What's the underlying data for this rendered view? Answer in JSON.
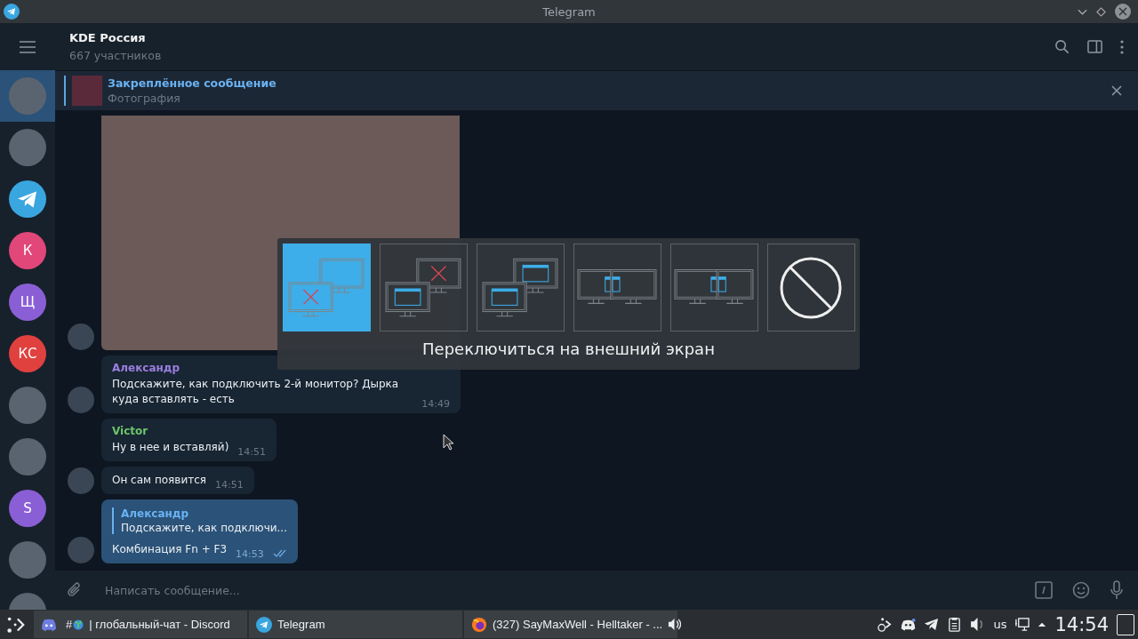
{
  "window": {
    "title": "Telegram"
  },
  "chat_list": [
    {
      "kind": "photo",
      "selected": true
    },
    {
      "kind": "photo",
      "selected": false
    },
    {
      "kind": "telegram",
      "selected": false
    },
    {
      "kind": "letter",
      "letter": "К",
      "color": "#e2477a",
      "selected": false
    },
    {
      "kind": "letter",
      "letter": "Щ",
      "color": "#8a5fd6",
      "selected": false
    },
    {
      "kind": "letter",
      "letter": "КС",
      "color": "#e0413f",
      "selected": false
    },
    {
      "kind": "photo",
      "selected": false
    },
    {
      "kind": "photo",
      "selected": false
    },
    {
      "kind": "letter",
      "letter": "S",
      "color": "#8a5fd6",
      "selected": false
    },
    {
      "kind": "photo",
      "selected": false
    },
    {
      "kind": "photo",
      "selected": false
    }
  ],
  "header": {
    "title": "KDE Россия",
    "subtitle": "667 участников"
  },
  "pinned": {
    "title": "Закреплённое сообщение",
    "text": "Фотография"
  },
  "messages": [
    {
      "kind": "photo",
      "avatar": true
    },
    {
      "kind": "text",
      "avatar": true,
      "author": "Александр",
      "color": "#9b7fe0",
      "text": "Подскажите, как подключить 2-й монитор? Дырка куда вставлять - есть",
      "time": "14:49"
    },
    {
      "kind": "text",
      "avatar": false,
      "author": "Victor",
      "color": "#6cc56a",
      "text": "Ну в нее и вставляй)",
      "time": "14:51"
    },
    {
      "kind": "text",
      "avatar": true,
      "text": "Он сам появится",
      "time": "14:51"
    },
    {
      "kind": "reply",
      "avatar": true,
      "reply_author": "Александр",
      "reply_text": "Подскажите, как подключи...",
      "text": "Комбинация Fn + F3",
      "time": "14:53",
      "read": true
    }
  ],
  "composer": {
    "placeholder": "Написать сообщение..."
  },
  "osd": {
    "caption": "Переключиться на внешний экран",
    "options": [
      {
        "kind": "external",
        "selected": true
      },
      {
        "kind": "internal",
        "selected": false
      },
      {
        "kind": "clone",
        "selected": false
      },
      {
        "kind": "extend-left",
        "selected": false
      },
      {
        "kind": "extend-right",
        "selected": false
      },
      {
        "kind": "none",
        "selected": false
      }
    ]
  },
  "taskbar": {
    "tasks": [
      {
        "kind": "discord",
        "prefix": "#",
        "label": "| глобальный-чат - Discord",
        "audio": false,
        "selected": false
      },
      {
        "kind": "telegram",
        "label": "Telegram",
        "audio": false,
        "selected": false
      },
      {
        "kind": "firefox",
        "label": "(327) SayMaxWell - Helltaker - ...",
        "audio": true,
        "selected": false
      }
    ],
    "keyboard_layout": "us",
    "clock": "14:54"
  }
}
